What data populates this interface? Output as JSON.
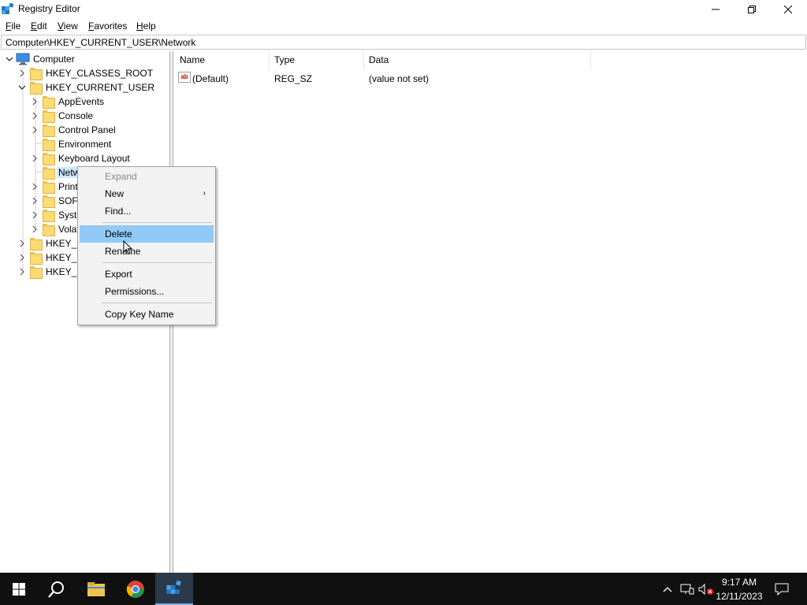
{
  "window": {
    "title": "Registry Editor"
  },
  "menu": {
    "items": [
      "File",
      "Edit",
      "View",
      "Favorites",
      "Help"
    ]
  },
  "address": {
    "path": "Computer\\HKEY_CURRENT_USER\\Network"
  },
  "tree": {
    "root": "Computer",
    "hives_top": [
      "HKEY_CLASSES_ROOT",
      "HKEY_CURRENT_USER"
    ],
    "hkcu_children": [
      "AppEvents",
      "Console",
      "Control Panel",
      "Environment",
      "Keyboard Layout",
      "Netw",
      "Print",
      "SOFT",
      "Syste",
      "Volat"
    ],
    "hives_bottom": [
      "HKEY_L",
      "HKEY_U",
      "HKEY_C"
    ],
    "selected": "Netw"
  },
  "list": {
    "columns": [
      "Name",
      "Type",
      "Data"
    ],
    "rows": [
      {
        "icon": "ab",
        "name": "(Default)",
        "type": "REG_SZ",
        "data": "(value not set)"
      }
    ]
  },
  "context_menu": {
    "items": [
      {
        "label": "Expand",
        "disabled": true
      },
      {
        "label": "New",
        "submenu": true
      },
      {
        "label": "Find..."
      },
      {
        "label": "Delete",
        "highlighted": true
      },
      {
        "label": "Rename"
      },
      {
        "label": "Export"
      },
      {
        "label": "Permissions..."
      },
      {
        "label": "Copy Key Name"
      }
    ]
  },
  "taskbar": {
    "time": "9:17 AM",
    "date": "12/11/2023",
    "icons": [
      "windows-start-icon",
      "search-icon",
      "file-explorer-icon",
      "chrome-icon",
      "registry-editor-icon"
    ],
    "tray_icons": [
      "chevron-up-icon",
      "network-icon",
      "volume-muted-icon",
      "notifications-icon"
    ]
  },
  "colors": {
    "selection": "#cce8ff",
    "menu_highlight": "#91c9f7",
    "taskbar": "#101010"
  }
}
